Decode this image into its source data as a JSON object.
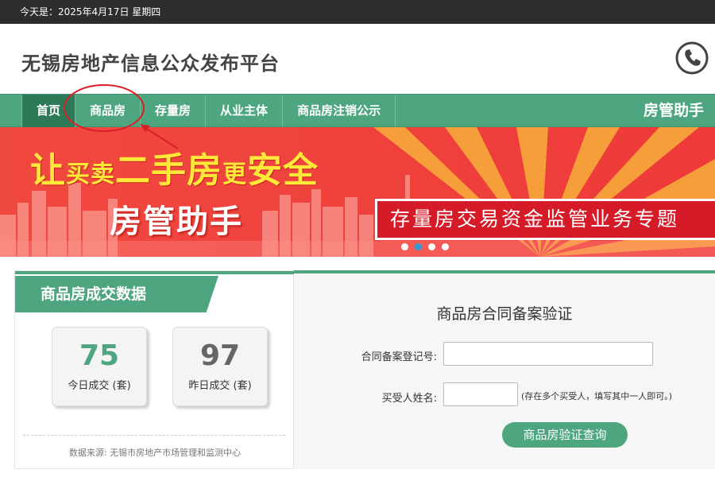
{
  "topbar": {
    "date_text": "今天是：2025年4月17日 星期四"
  },
  "header": {
    "site_title": "无锡房地产信息公众发布平台",
    "phone_icon": "phone-icon"
  },
  "nav": {
    "items": [
      {
        "label": "首页",
        "active": true
      },
      {
        "label": "商品房",
        "active": false
      },
      {
        "label": "存量房",
        "active": false
      },
      {
        "label": "从业主体",
        "active": false
      },
      {
        "label": "商品房注销公示",
        "active": false
      }
    ],
    "right_label": "房管助手"
  },
  "banner": {
    "slogan_1": "让",
    "slogan_2": "买卖",
    "slogan_3": "二手房",
    "slogan_4": "更",
    "slogan_5": "安全",
    "app_name": "房管助手",
    "special_topic": "存量房交易资金监管业务专题",
    "slide_count": 4,
    "active_slide": 2
  },
  "stats": {
    "header": "商品房成交数据",
    "today_value": "75",
    "today_label": "今日成交 (套)",
    "yesterday_value": "97",
    "yesterday_label": "昨日成交 (套)",
    "source": "数据来源:  无锡市房地产市场管理和监测中心"
  },
  "verify": {
    "title": "商品房合同备案验证",
    "contract_label": "合同备案登记号:",
    "contract_value": "",
    "buyer_label": "买受人姓名:",
    "buyer_value": "",
    "buyer_hint": "(存在多个买受人，填写其中一人即可。)",
    "button_label": "商品房验证查询"
  },
  "colors": {
    "brand_green": "#4da67f",
    "banner_red": "#ef3d3c",
    "annotation_red": "#d9202a"
  }
}
